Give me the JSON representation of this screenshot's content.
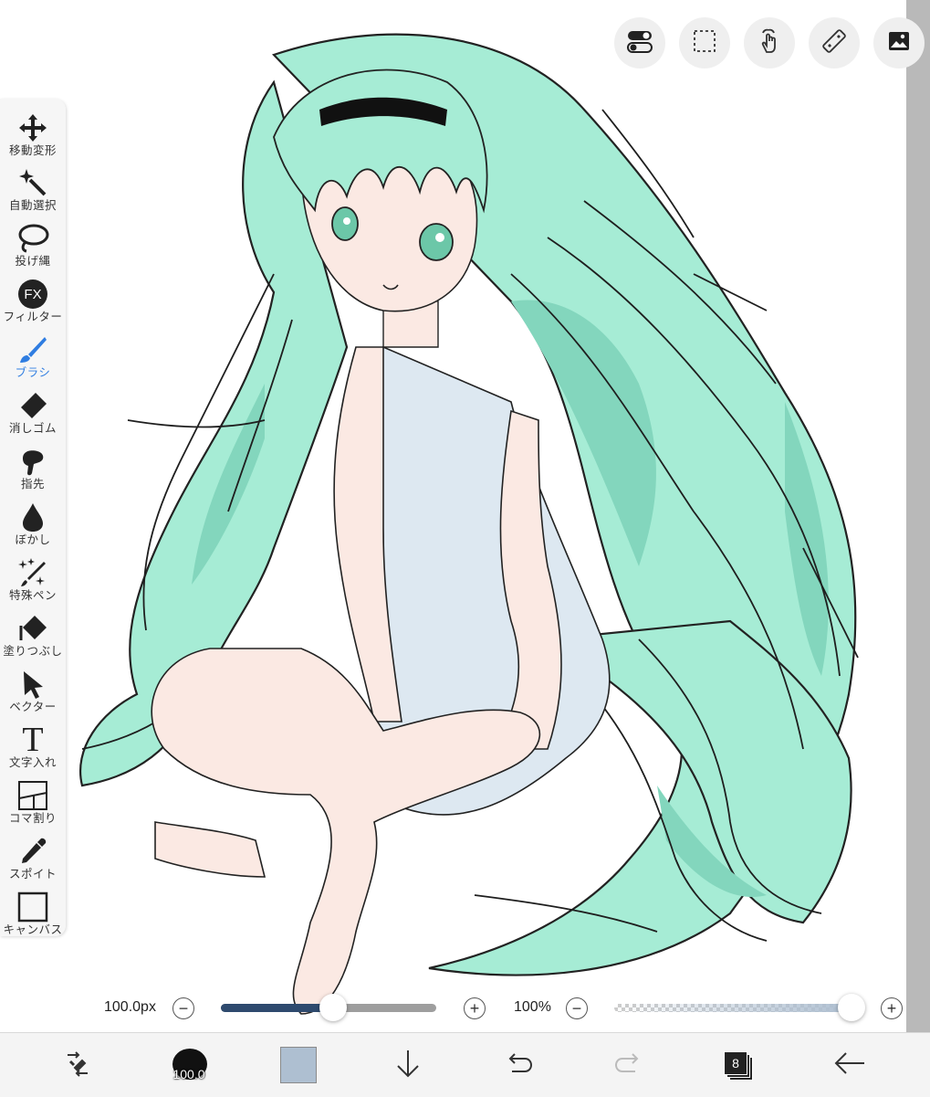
{
  "tools": [
    {
      "label": "移動変形",
      "icon": "move-transform-icon"
    },
    {
      "label": "自動選択",
      "icon": "magic-wand-icon"
    },
    {
      "label": "投げ縄",
      "icon": "lasso-icon"
    },
    {
      "label": "フィルター",
      "icon": "fx-filter-icon"
    },
    {
      "label": "ブラシ",
      "icon": "brush-icon",
      "active": true
    },
    {
      "label": "消しゴム",
      "icon": "eraser-icon"
    },
    {
      "label": "指先",
      "icon": "finger-smudge-icon"
    },
    {
      "label": "ぼかし",
      "icon": "blur-drop-icon"
    },
    {
      "label": "特殊ペン",
      "icon": "special-pen-icon"
    },
    {
      "label": "塗りつぶし",
      "icon": "fill-bucket-icon"
    },
    {
      "label": "ベクター",
      "icon": "vector-arrow-icon"
    },
    {
      "label": "文字入れ",
      "icon": "text-t-icon"
    },
    {
      "label": "コマ割り",
      "icon": "panel-divide-icon"
    },
    {
      "label": "スポイト",
      "icon": "eyedropper-icon"
    },
    {
      "label": "キャンバス",
      "icon": "canvas-square-icon"
    }
  ],
  "fx_text": "FX",
  "top_buttons": [
    "toggle-switch-icon",
    "selection-rect-icon",
    "touch-gesture-icon",
    "ruler-icon",
    "image-gallery-icon"
  ],
  "brush_size": {
    "label": "100.0px",
    "value": 100.0,
    "fraction": 0.52,
    "minus": "−",
    "plus": "+"
  },
  "opacity": {
    "label": "100%",
    "value": 100,
    "fraction": 1.0,
    "minus": "−",
    "plus": "+"
  },
  "bottom": {
    "brush_preview_value": "100.0",
    "current_color": "#aebfd1",
    "layer_count": "8"
  },
  "colors": {
    "accent": "#2f7de1",
    "hair": "#9fe7cf",
    "hair_shade": "#7ed3bb",
    "skin": "#fbe9e3",
    "dress": "#dde8f1",
    "size_slider_fill": "#2e4a6e"
  }
}
